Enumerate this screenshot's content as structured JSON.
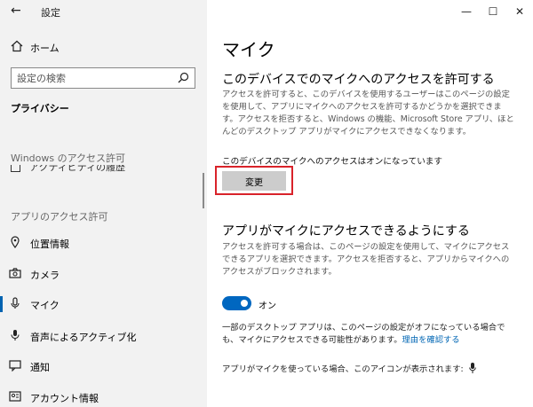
{
  "window": {
    "title": "設定",
    "back_glyph": "←",
    "minimize_glyph": "—",
    "maximize_glyph": "☐",
    "close_glyph": "✕"
  },
  "sidebar": {
    "home_label": "ホーム",
    "search_placeholder": "設定の検索",
    "category": "プライバシー",
    "windows_perm_header": "Windows のアクセス許可",
    "clipped_item_label": "アクティビティの履歴",
    "app_perm_header": "アプリのアクセス許可",
    "items": [
      {
        "label": "位置情報",
        "icon": "location-icon"
      },
      {
        "label": "カメラ",
        "icon": "camera-icon"
      },
      {
        "label": "マイク",
        "icon": "microphone-icon",
        "selected": true
      },
      {
        "label": "音声によるアクティブ化",
        "icon": "voice-activation-icon"
      },
      {
        "label": "通知",
        "icon": "notification-icon"
      },
      {
        "label": "アカウント情報",
        "icon": "account-icon"
      }
    ]
  },
  "main": {
    "title": "マイク",
    "section1": {
      "heading": "このデバイスでのマイクへのアクセスを許可する",
      "description": "アクセスを許可すると、このデバイスを使用するユーザーはこのページの設定を使用して、アプリにマイクへのアクセスを許可するかどうかを選択できます。アクセスを拒否すると、Windows の機能、Microsoft Store アプリ、ほとんどのデスクトップ アプリがマイクにアクセスできなくなります。",
      "status": "このデバイスのマイクへのアクセスはオンになっています",
      "change_button": "変更"
    },
    "section2": {
      "heading": "アプリがマイクにアクセスできるようにする",
      "description": "アクセスを許可する場合は、このページの設定を使用して、マイクにアクセスできるアプリを選択できます。アクセスを拒否すると、アプリからマイクへのアクセスがブロックされます。",
      "toggle_state": "オン",
      "toggle_on": true
    },
    "note_prefix": "一部のデスクトップ アプリは、このページの設定がオフになっている場合でも、マイクにアクセスできる可能性があります。",
    "note_link": "理由を確認する",
    "icon_note": "アプリがマイクを使っている場合、このアイコンが表示されます:"
  },
  "colors": {
    "accent": "#0067c0",
    "highlight_border": "#d9232a",
    "sidebar_bg": "#f2f2f2"
  }
}
